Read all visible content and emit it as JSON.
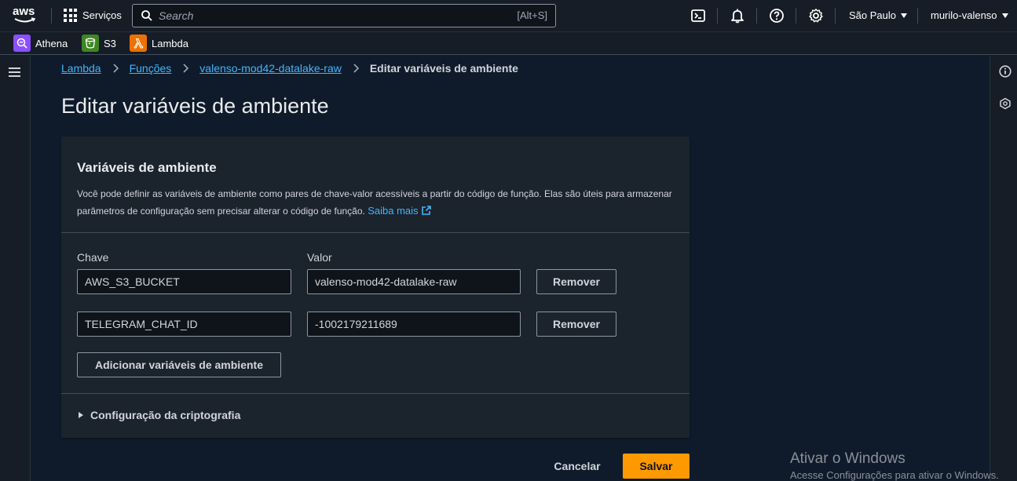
{
  "topnav": {
    "logo_text": "aws",
    "services_label": "Serviços",
    "search_placeholder": "Search",
    "search_shortcut": "[Alt+S]",
    "region": "São Paulo",
    "user": "murilo-valenso"
  },
  "favorites": [
    {
      "label": "Athena",
      "color": "#8c4fff"
    },
    {
      "label": "S3",
      "color": "#3f8624"
    },
    {
      "label": "Lambda",
      "color": "#ed7100"
    }
  ],
  "breadcrumb": {
    "items": [
      "Lambda",
      "Funções",
      "valenso-mod42-datalake-raw"
    ],
    "current": "Editar variáveis de ambiente"
  },
  "page": {
    "title": "Editar variáveis de ambiente"
  },
  "env_section": {
    "title": "Variáveis de ambiente",
    "description": "Você pode definir as variáveis de ambiente como pares de chave-valor acessíveis a partir do código de função. Elas são úteis para armazenar parâmetros de configuração sem precisar alterar o código de função.",
    "learn_more": "Saiba mais",
    "key_label": "Chave",
    "value_label": "Valor",
    "rows": [
      {
        "key": "AWS_S3_BUCKET",
        "value": "valenso-mod42-datalake-raw",
        "remove_label": "Remover"
      },
      {
        "key": "TELEGRAM_CHAT_ID",
        "value": "-1002179211689",
        "remove_label": "Remover"
      }
    ],
    "add_label": "Adicionar variáveis de ambiente",
    "encryption_label": "Configuração da criptografia"
  },
  "actions": {
    "cancel": "Cancelar",
    "save": "Salvar"
  },
  "watermark": {
    "title": "Ativar o Windows",
    "subtitle": "Acesse Configurações para ativar o Windows."
  },
  "colors": {
    "accent": "#ff9900",
    "link": "#42b4ff",
    "nav_bg": "#161d26",
    "page_bg": "#0f1b2a"
  }
}
